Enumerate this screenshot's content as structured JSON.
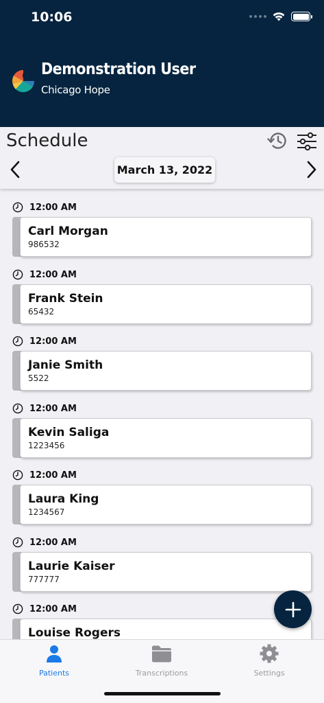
{
  "status": {
    "time": "10:06"
  },
  "user": {
    "name": "Demonstration User",
    "organization": "Chicago Hope"
  },
  "schedule": {
    "title": "Schedule",
    "date": "March 13, 2022"
  },
  "appointments": [
    {
      "time": "12:00 AM",
      "name": "Carl Morgan",
      "id": "986532"
    },
    {
      "time": "12:00 AM",
      "name": "Frank Stein",
      "id": "65432"
    },
    {
      "time": "12:00 AM",
      "name": "Janie Smith",
      "id": "5522"
    },
    {
      "time": "12:00 AM",
      "name": "Kevin Saliga",
      "id": "1223456"
    },
    {
      "time": "12:00 AM",
      "name": "Laura King",
      "id": "1234567"
    },
    {
      "time": "12:00 AM",
      "name": "Laurie Kaiser",
      "id": "777777"
    },
    {
      "time": "12:00 AM",
      "name": "Louise Rogers",
      "id": ""
    }
  ],
  "tabs": [
    {
      "label": "Patients",
      "icon": "person-icon",
      "active": true
    },
    {
      "label": "Transcriptions",
      "icon": "folder-icon",
      "active": false
    },
    {
      "label": "Settings",
      "icon": "gear-icon",
      "active": false
    }
  ],
  "colors": {
    "header": "#06243f",
    "accent": "#1a7ae6",
    "background": "#f0f0f5"
  }
}
